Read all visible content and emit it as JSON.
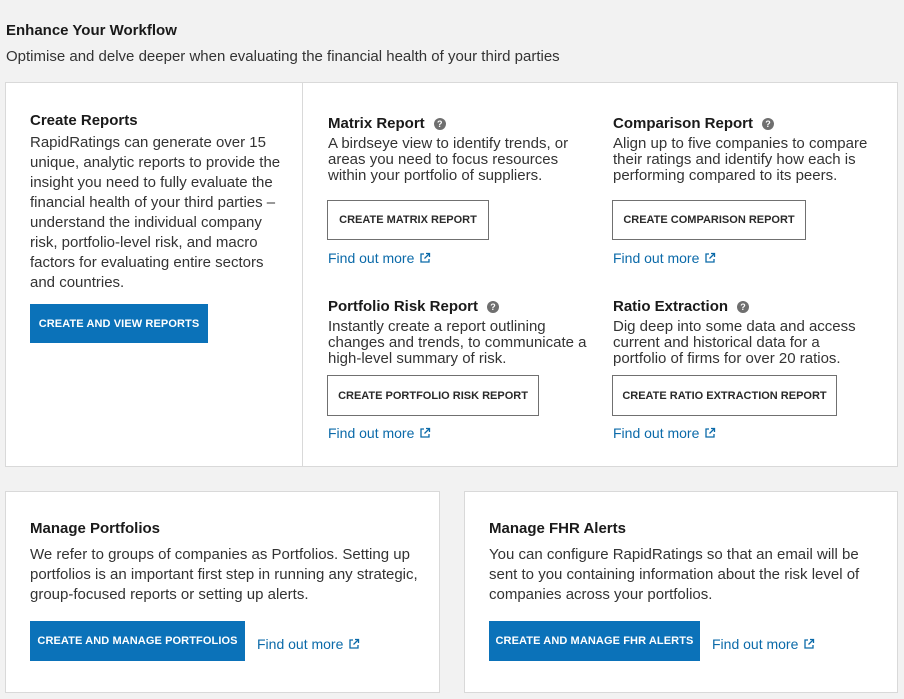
{
  "header": {
    "title": "Enhance Your Workflow",
    "subtitle": "Optimise and delve deeper when evaluating the financial health of your third parties"
  },
  "create_reports": {
    "title": "Create Reports",
    "description": "RapidRatings can generate over 15 unique, analytic reports to provide the insight you need to fully evaluate the financial health of your third parties – understand the individual company risk, portfolio-level risk, and macro factors for evaluating entire sectors and countries.",
    "button_label": "CREATE AND VIEW REPORTS"
  },
  "matrix_report": {
    "title": "Matrix Report",
    "description": "A birdseye view to identify trends, or areas you need to focus resources within your portfolio of suppliers.",
    "button_label": "CREATE MATRIX REPORT",
    "link_label": "Find out more"
  },
  "comparison_report": {
    "title": "Comparison Report",
    "description": "Align up to five companies to compare their ratings and identify how each is performing compared to its peers.",
    "button_label": "CREATE COMPARISON REPORT",
    "link_label": "Find out more"
  },
  "portfolio_risk_report": {
    "title": "Portfolio Risk Report",
    "description": "Instantly create a report outlining changes and trends, to communicate a high-level summary of risk.",
    "button_label": "CREATE PORTFOLIO RISK REPORT",
    "link_label": "Find out more"
  },
  "ratio_extraction": {
    "title": "Ratio Extraction",
    "description": "Dig deep into some data and access current and historical data for a portfolio of firms for over 20 ratios.",
    "button_label": "CREATE RATIO EXTRACTION REPORT",
    "link_label": "Find out more"
  },
  "manage_portfolios": {
    "title": "Manage Portfolios",
    "description": "We refer to groups of companies as Portfolios. Setting up portfolios is an important first step in running any strategic, group-focused reports or setting up alerts.",
    "button_label": "CREATE AND MANAGE PORTFOLIOS",
    "link_label": "Find out more"
  },
  "manage_alerts": {
    "title": "Manage FHR Alerts",
    "description": "You can configure RapidRatings so that an email will be sent to you containing information about the risk level of companies across your portfolios.",
    "button_label": "CREATE AND MANAGE FHR ALERTS",
    "link_label": "Find out more"
  },
  "icons": {
    "help": "?",
    "external_link": "external-link-icon"
  },
  "colors": {
    "primary": "#0b72b9",
    "link": "#0b6aa9",
    "border": "#d9d9d9",
    "background": "#f2f2f2"
  }
}
